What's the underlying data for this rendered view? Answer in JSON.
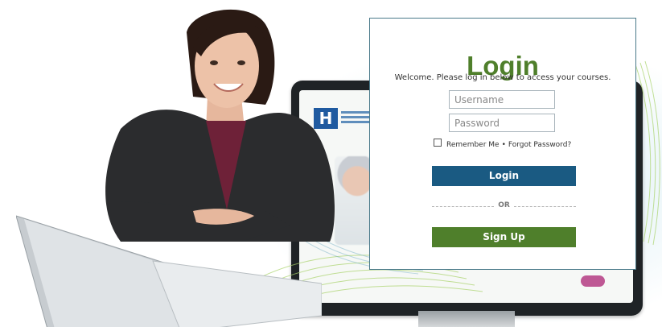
{
  "login": {
    "title": "Login",
    "welcome": "Welcome. Please log in below to access your courses.",
    "username_placeholder": "Username",
    "password_placeholder": "Password",
    "remember_label": "Remember Me",
    "separator": "•",
    "forgot_label": "Forgot Password?",
    "login_button": "Login",
    "or_divider": "OR",
    "signup_button": "Sign Up"
  },
  "colors": {
    "title_green": "#4f7f2b",
    "login_button_blue": "#1a5a82",
    "signup_button_green": "#4f7f2b",
    "card_border": "#4a7a8a"
  }
}
